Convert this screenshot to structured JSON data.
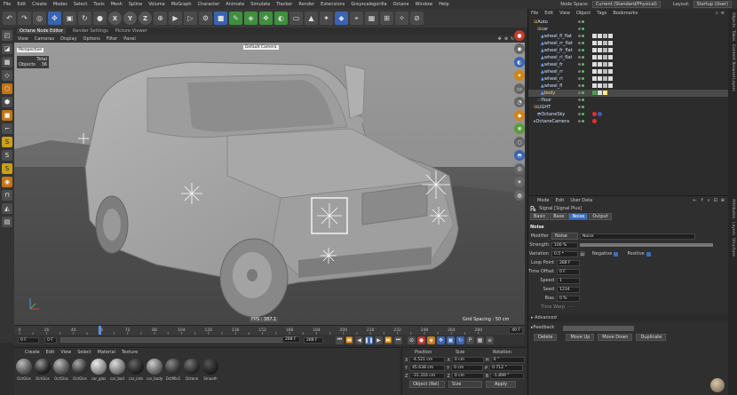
{
  "menubar": {
    "items": [
      "File",
      "Edit",
      "Create",
      "Modes",
      "Select",
      "Tools",
      "Mesh",
      "Spline",
      "Volume",
      "MoGraph",
      "Character",
      "Animate",
      "Simulate",
      "Tracker",
      "Render",
      "Extensions",
      "Greyscalegorilla",
      "Octane",
      "Window",
      "Help"
    ],
    "node_space_label": "Node Space:",
    "node_space_value": "Current (Standard/Physical)",
    "layout_label": "Layout:",
    "layout_value": "Startup (User)"
  },
  "toolbar": {
    "x": "X",
    "y": "Y",
    "z": "Z"
  },
  "tabs": [
    "Octane Node Editor",
    "Render Settings",
    "Picture Viewer"
  ],
  "viewport": {
    "menu": [
      "View",
      "Cameras",
      "Display",
      "Options",
      "Filter",
      "Panel"
    ],
    "projection": "Perspective",
    "camera": "Default Camera",
    "stats": {
      "total_label": "Total",
      "objects_label": "Objects",
      "objects_value": "36"
    },
    "fps": "FPS : 387.1",
    "grid_spacing": "Grid Spacing : 50 cm"
  },
  "timeline": {
    "ticks": [
      "0",
      "8",
      "16",
      "32",
      "40",
      "48",
      "56",
      "64",
      "72",
      "80",
      "88",
      "96",
      "104",
      "112",
      "120",
      "128",
      "136",
      "144",
      "152",
      "160",
      "168",
      "176",
      "184",
      "192",
      "200",
      "208",
      "216",
      "224",
      "232",
      "240",
      "248",
      "256",
      "264",
      "272",
      "280"
    ],
    "end_label": "40 F",
    "current_frame": "0 F",
    "start_field": "0 F",
    "end_field": "288 F",
    "end_field2": "288 F"
  },
  "material_manager": {
    "menu": [
      "Create",
      "Edit",
      "View",
      "Select",
      "Material",
      "Texture"
    ],
    "materials": [
      "OctGlos",
      "OctGlos",
      "OctGlos",
      "OctGlos",
      "car_glas",
      "car_bod",
      "car_inte",
      "car_body",
      "OctMix1",
      "Octane",
      "Smooth"
    ]
  },
  "coordinates": {
    "headers": [
      "Position",
      "Size",
      "Rotation"
    ],
    "rows": [
      {
        "axis": "X",
        "pos": "-4.521 cm",
        "size_axis": "X",
        "size": "0 cm",
        "rot_axis": "H",
        "rot": "0 °"
      },
      {
        "axis": "Y",
        "pos": "45.638 cm",
        "size_axis": "Y",
        "size": "0 cm",
        "rot_axis": "P",
        "rot": "0.712 °"
      },
      {
        "axis": "Z",
        "pos": "-31.316 cm",
        "size_axis": "Z",
        "size": "0 cm",
        "rot_axis": "B",
        "rot": "-1.899 °"
      }
    ],
    "mode_dropdown": "Object (Rel)",
    "size_dropdown": "Size",
    "apply_label": "Apply"
  },
  "object_manager": {
    "menu": [
      "File",
      "Edit",
      "View",
      "Object",
      "Tags",
      "Bookmarks"
    ],
    "objects": [
      {
        "label": "Auto",
        "indent": 0
      },
      {
        "label": "car",
        "indent": 1
      },
      {
        "label": "wheel_fl_flat",
        "indent": 2
      },
      {
        "label": "wheel_rr_flat",
        "indent": 2
      },
      {
        "label": "wheel_fr_flat",
        "indent": 2
      },
      {
        "label": "wheel_rl_flat",
        "indent": 2
      },
      {
        "label": "wheel_fr",
        "indent": 2
      },
      {
        "label": "wheel_rr",
        "indent": 2
      },
      {
        "label": "wheel_rl",
        "indent": 2
      },
      {
        "label": "wheel_fl",
        "indent": 2
      },
      {
        "label": "body",
        "indent": 2
      },
      {
        "label": "floor",
        "indent": 1
      },
      {
        "label": "LIGHT",
        "indent": 0
      },
      {
        "label": "OctaneSky",
        "indent": 1
      },
      {
        "label": "OctaneCamera",
        "indent": 0
      }
    ]
  },
  "attributes": {
    "menu": [
      "Mode",
      "Edit",
      "User Data"
    ],
    "title": "Signal [Signal Plus]",
    "tabs": [
      "Basic",
      "Base",
      "Noise",
      "Output"
    ],
    "active_tab": "Noise",
    "section": "Noise",
    "modifier_label": "Modifier",
    "modifier_value": "Noise",
    "modifier_type": "Noise",
    "strength_label": "Strength",
    "strength_value": "100 %",
    "variation_label": "Variation",
    "variation_value": "0.5 *",
    "negative_label": "Negative",
    "positive_label": "Positive",
    "loop_point_label": "Loop Point",
    "loop_point_value": "288 F",
    "time_offset_label": "Time Offset",
    "time_offset_value": "0 F",
    "speed_label": "Speed",
    "speed_value": "1",
    "seed_label": "Seed",
    "seed_value": "1234",
    "bias_label": "Bias",
    "bias_value": "0 %",
    "time_warp_label": "Time Warp",
    "advanced_label": "Advanced",
    "feedback_label": "Feedback",
    "buttons": [
      "Delete",
      "Move Up",
      "Move Down",
      "Duplicate"
    ],
    "strength_fraction": 1.0
  },
  "side_tabs": {
    "top": [
      "Objects",
      "Takes",
      "Content Browser",
      "Layers"
    ],
    "bottom": [
      "Attributes",
      "Layers",
      "Structure"
    ]
  }
}
